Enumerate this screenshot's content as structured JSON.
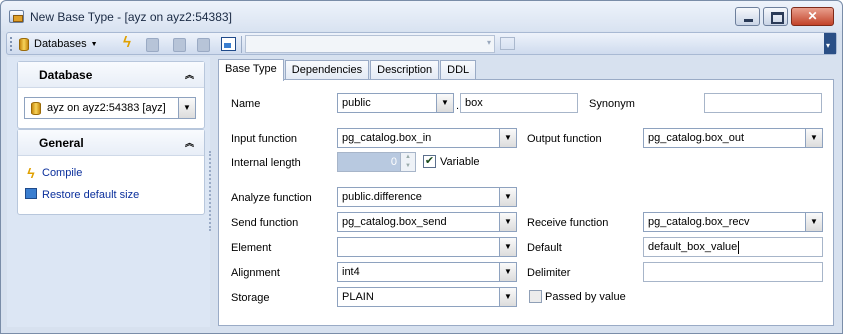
{
  "window": {
    "title": "New Base Type - [ayz on ayz2:54383]"
  },
  "toolbar": {
    "databases_label": "Databases",
    "combo_value": ""
  },
  "sidebar": {
    "database_panel_title": "Database",
    "selected_database": "ayz on ayz2:54383 [ayz]",
    "general_panel_title": "General",
    "actions": [
      {
        "label": "Compile",
        "icon": "bolt-icon"
      },
      {
        "label": "Restore default size",
        "icon": "restore-size-icon"
      }
    ]
  },
  "tabs": [
    "Base Type",
    "Dependencies",
    "Description",
    "DDL"
  ],
  "form": {
    "name_label": "Name",
    "schema_value": "public",
    "name_dot": ".",
    "name_value": "box",
    "synonym_label": "Synonym",
    "synonym_value": "",
    "input_function_label": "Input function",
    "input_function_value": "pg_catalog.box_in",
    "output_function_label": "Output function",
    "output_function_value": "pg_catalog.box_out",
    "internal_length_label": "Internal length",
    "internal_length_value": "0",
    "variable_label": "Variable",
    "variable_checked": true,
    "analyze_function_label": "Analyze function",
    "analyze_function_value": "public.difference",
    "send_function_label": "Send function",
    "send_function_value": "pg_catalog.box_send",
    "receive_function_label": "Receive function",
    "receive_function_value": "pg_catalog.box_recv",
    "element_label": "Element",
    "element_value": "",
    "default_label": "Default",
    "default_value": "default_box_value",
    "alignment_label": "Alignment",
    "alignment_value": "int4",
    "delimiter_label": "Delimiter",
    "delimiter_value": "",
    "storage_label": "Storage",
    "storage_value": "PLAIN",
    "passed_by_value_label": "Passed by value",
    "passed_by_value_checked": false
  }
}
